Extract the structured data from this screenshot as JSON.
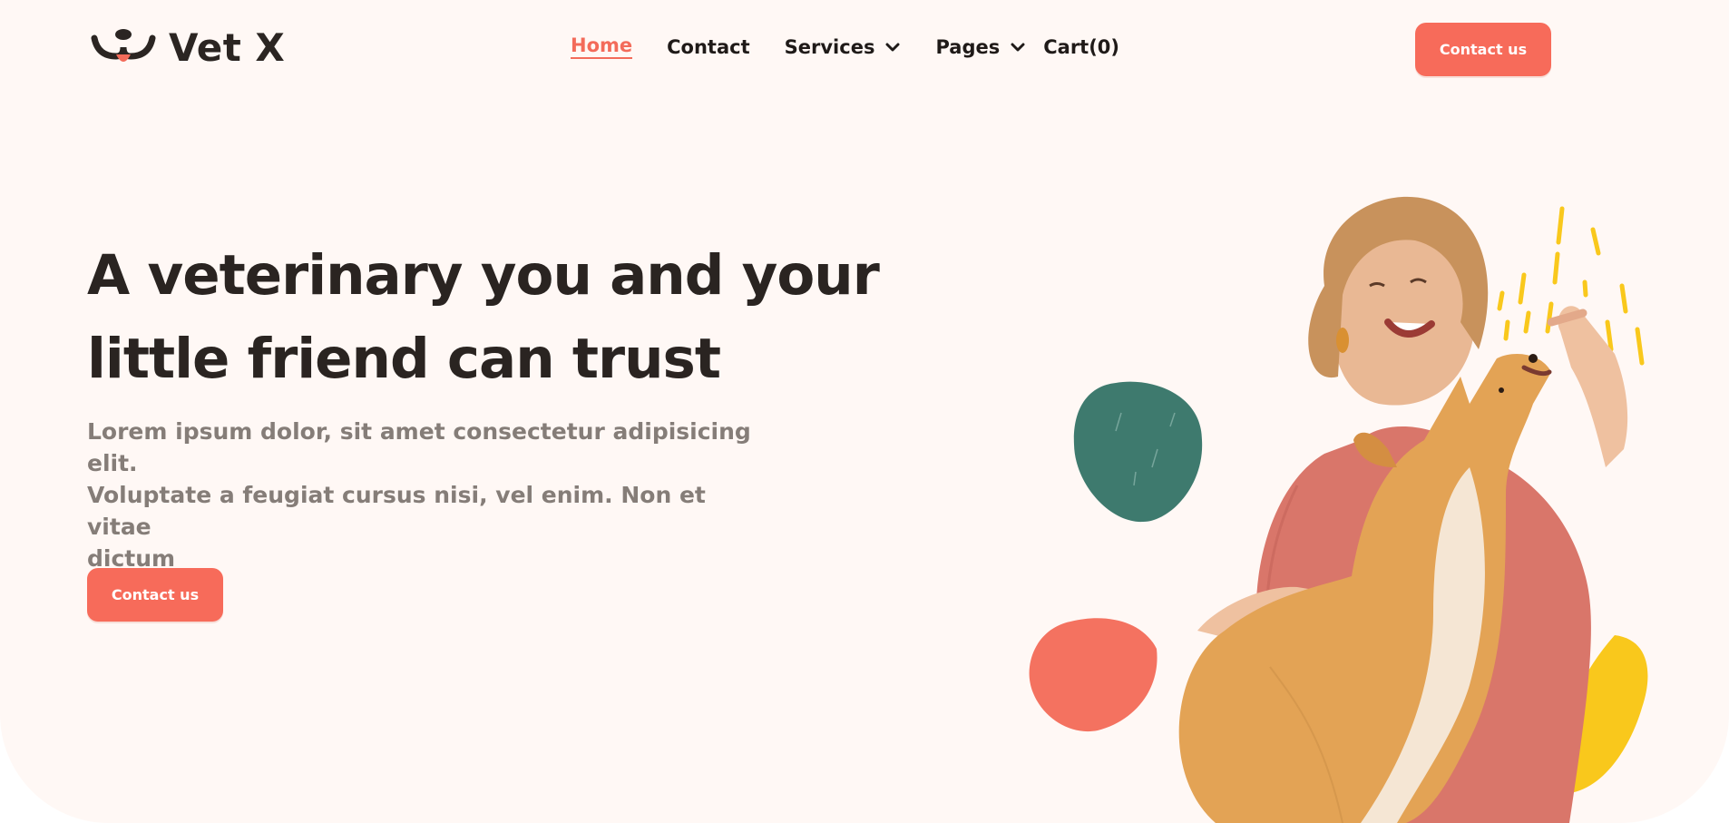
{
  "brand": {
    "name": "Vet X",
    "logo_icon": "paw-smile-icon",
    "accent": "#f76b5a"
  },
  "nav": {
    "items": [
      {
        "label": "Home",
        "active": true
      },
      {
        "label": "Contact"
      },
      {
        "label": "Services",
        "has_dropdown": true
      },
      {
        "label": "Pages",
        "has_dropdown": true
      },
      {
        "label": "Cart(0)"
      }
    ]
  },
  "header": {
    "cta_label": "Contact us"
  },
  "hero": {
    "title_line1": "A veterinary you and your",
    "title_line2": "little friend can trust",
    "subtitle_line1": "Lorem ipsum dolor, sit amet consectetur adipisicing elit.",
    "subtitle_line2": "Voluptate a feugiat cursus nisi, vel enim. Non et vitae",
    "subtitle_line3": "dictum",
    "cta_label": "Contact us"
  },
  "illustration": {
    "subject": "woman-feeding-corgi",
    "colors": {
      "teal_blob": "#3e7a6e",
      "coral_blob": "#f47260",
      "yellow_blob": "#f9c81c",
      "sweater": "#d9766a",
      "dog_fur": "#e3a355"
    }
  }
}
